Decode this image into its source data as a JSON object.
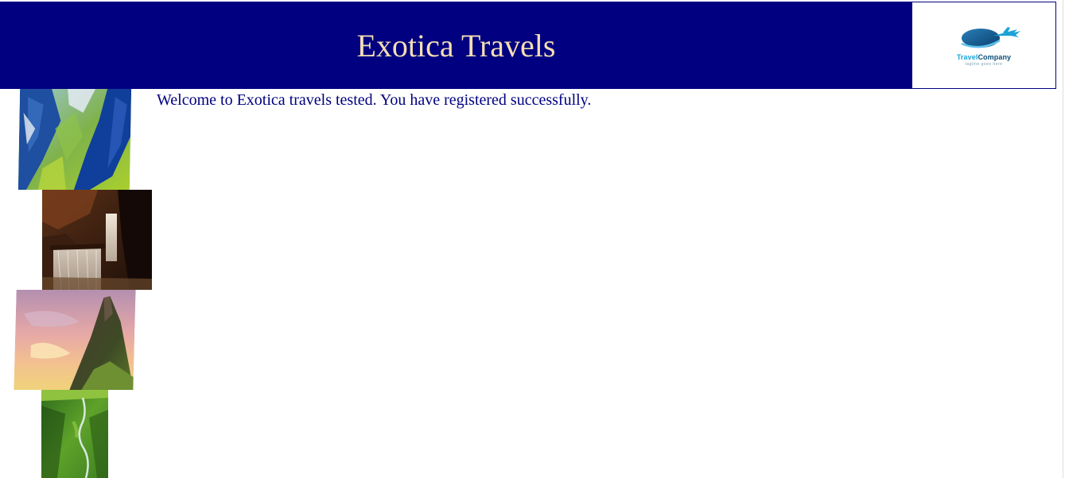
{
  "header": {
    "title": "Exotica Travels",
    "background_color": "#000080",
    "title_color": "#f5deb3"
  },
  "logo": {
    "brand_part1": "Travel",
    "brand_part2": "Company",
    "tagline": "tagline goes here",
    "icon": "airplane-globe-icon"
  },
  "main": {
    "welcome_message": "Welcome to Exotica travels tested. You have registered successfully.",
    "text_color": "#000080"
  },
  "gallery": {
    "images": [
      {
        "subject": "aerial view of blue glacial river over green valley"
      },
      {
        "subject": "waterfall in dark brown rocky gorge"
      },
      {
        "subject": "steep mountain peak against pink sunset sky"
      },
      {
        "subject": "green valley with winding river"
      }
    ]
  }
}
